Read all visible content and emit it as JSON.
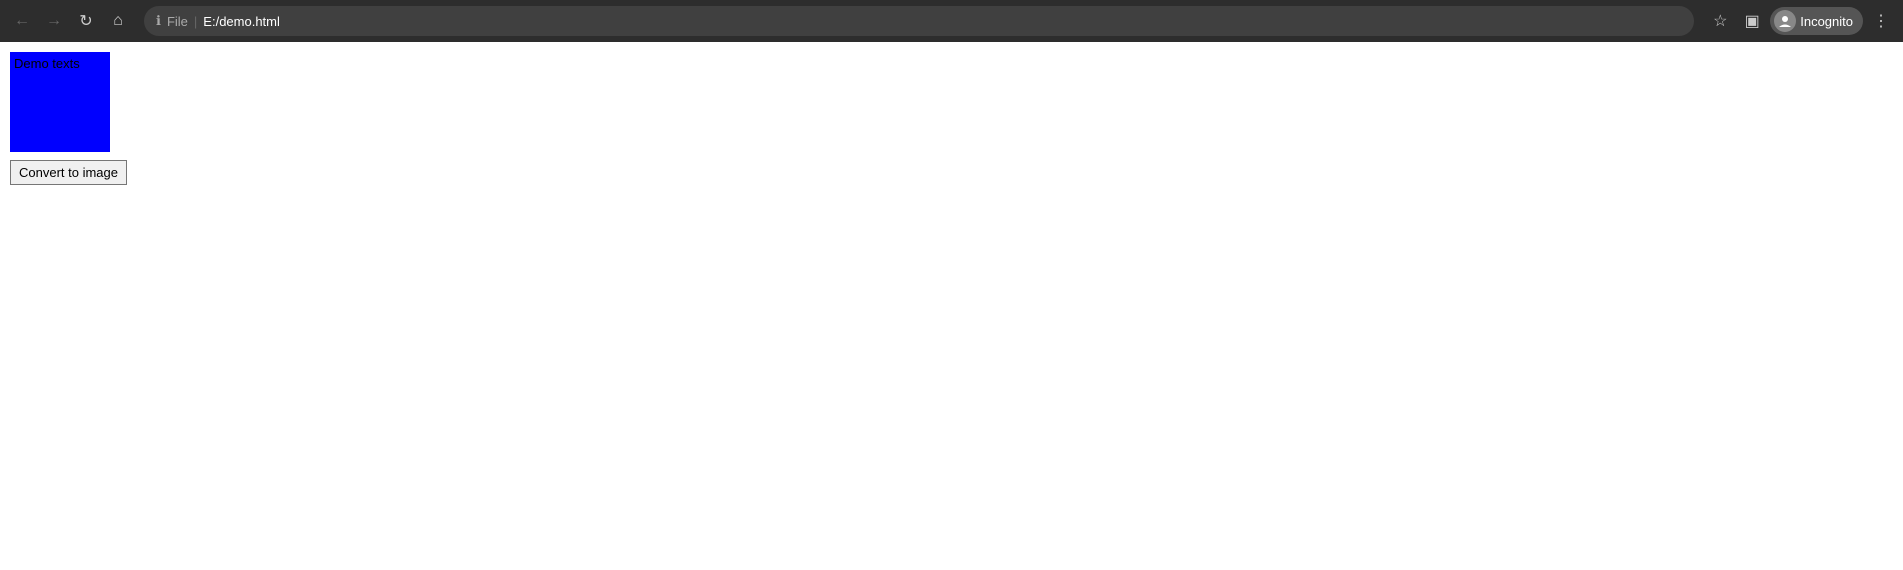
{
  "browser": {
    "address": {
      "file_label": "File",
      "separator": "|",
      "path": "E:/demo.html"
    },
    "incognito_label": "Incognito",
    "nav": {
      "back_label": "←",
      "forward_label": "→",
      "reload_label": "↻",
      "home_label": "⌂"
    }
  },
  "page": {
    "demo_text": "Demo texts",
    "box_color": "#0000ff",
    "convert_button_label": "Convert to image"
  }
}
